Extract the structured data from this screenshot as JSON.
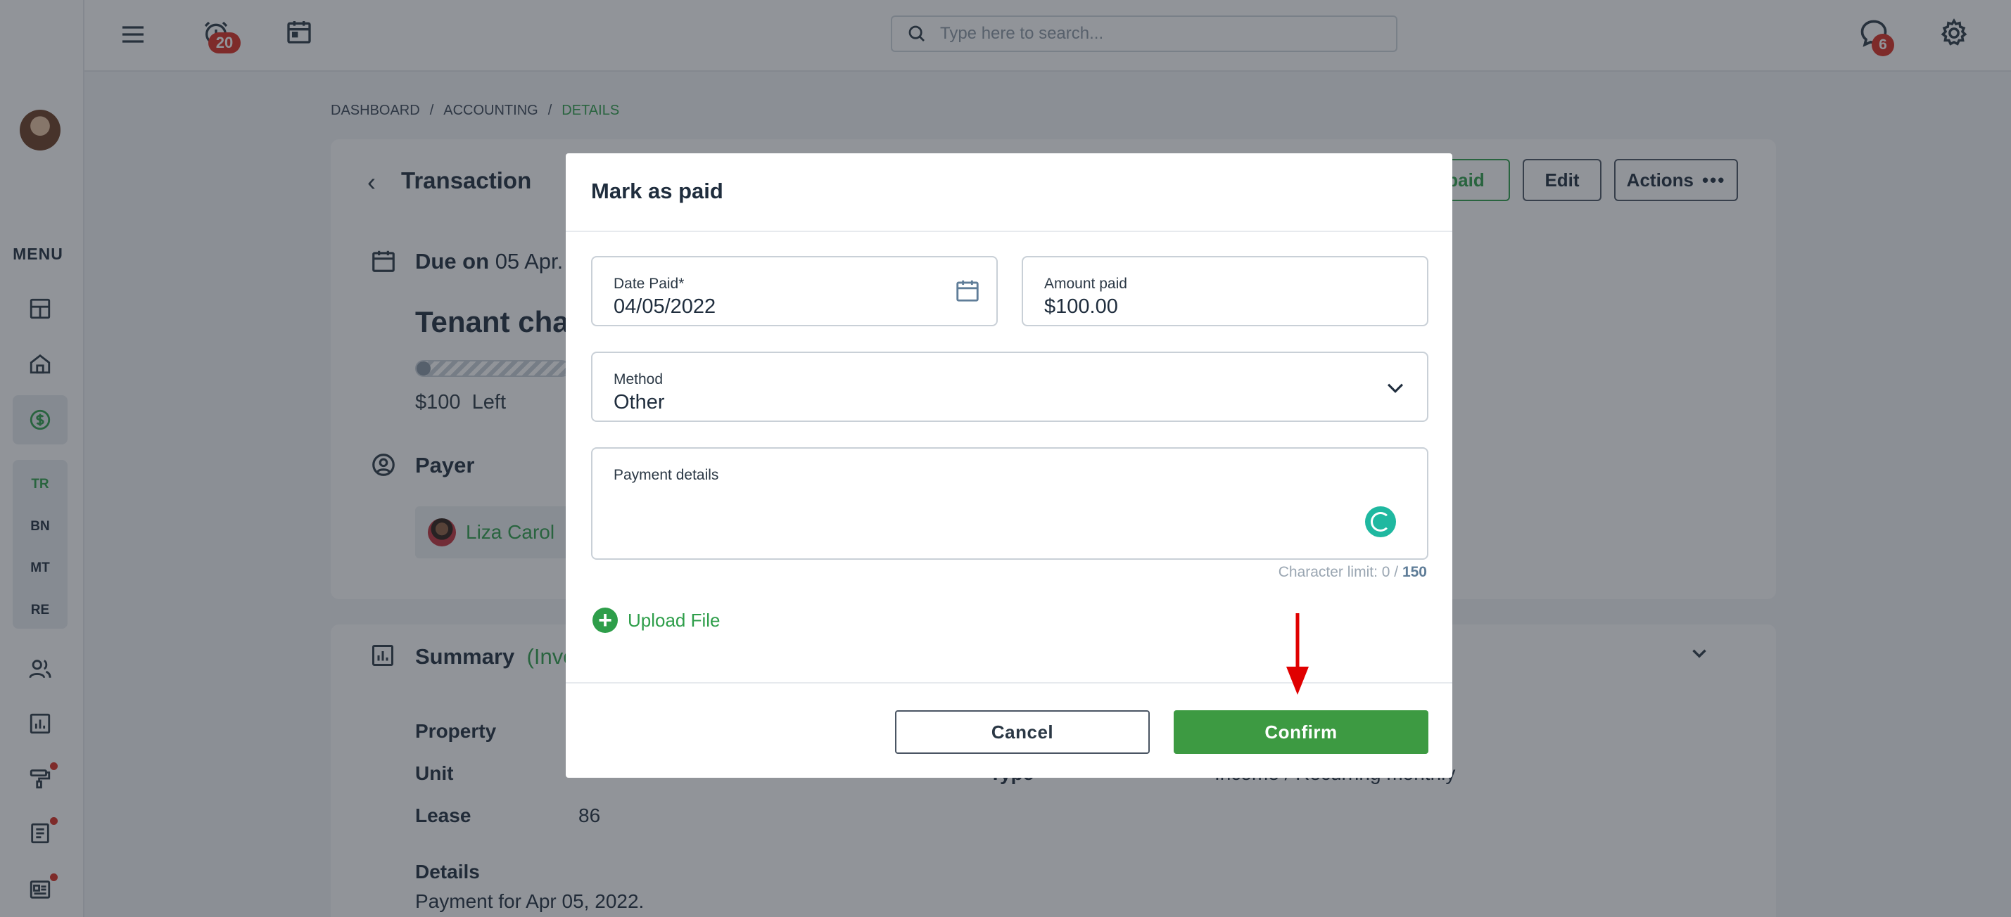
{
  "topbar": {
    "alarm_badge": "20",
    "chat_badge": "6",
    "search_placeholder": "Type here to search..."
  },
  "sidebar": {
    "menu_label": "MENU",
    "sub_items": [
      "TR",
      "BN",
      "MT",
      "RE"
    ]
  },
  "breadcrumb": {
    "items": [
      "DASHBOARD",
      "ACCOUNTING",
      "DETAILS"
    ],
    "separator": "/"
  },
  "transaction": {
    "title": "Transaction",
    "paid_button": "paid",
    "edit_button": "Edit",
    "actions_button": "Actions",
    "due_prefix": "Due on",
    "due_date": "05 Apr.",
    "charge_title": "Tenant cha",
    "amount_left": "$100",
    "left_label": "Left",
    "payer_heading": "Payer",
    "payer_name": "Liza Carol"
  },
  "summary": {
    "title": "Summary",
    "title_suffix": "(Invo",
    "rows": [
      {
        "label": "Property",
        "value": ""
      },
      {
        "label": "Unit",
        "value": ""
      },
      {
        "label": "Lease",
        "value": "86"
      }
    ],
    "type_label": "Type",
    "type_value": "Income / Recurring monthly",
    "details_label": "Details",
    "details_value": "Payment for Apr 05, 2022."
  },
  "modal": {
    "title": "Mark as paid",
    "date_paid_label": "Date Paid*",
    "date_paid_value": "04/05/2022",
    "amount_paid_label": "Amount paid",
    "amount_paid_value": "$100.00",
    "method_label": "Method",
    "method_value": "Other",
    "payment_details_label": "Payment details",
    "payment_details_value": "",
    "char_limit_prefix": "Character limit: 0 /",
    "char_limit_max": "150",
    "upload_label": "Upload File",
    "cancel_label": "Cancel",
    "confirm_label": "Confirm"
  },
  "colors": {
    "accent_green": "#3d9a42",
    "badge_red": "#d92d20",
    "spinner_teal": "#1fb8a0",
    "annotation_arrow": "#e00000"
  }
}
